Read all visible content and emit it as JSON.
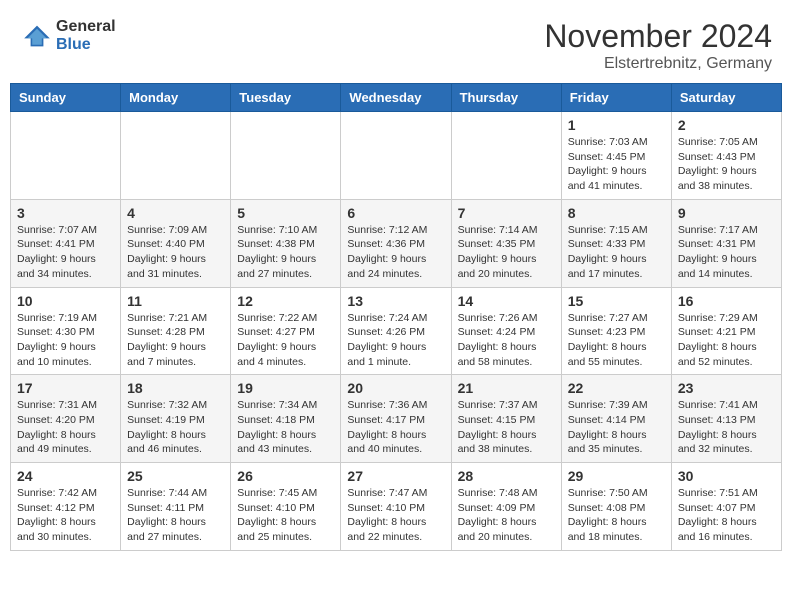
{
  "header": {
    "logo_general": "General",
    "logo_blue": "Blue",
    "month_title": "November 2024",
    "location": "Elstertrebnitz, Germany"
  },
  "calendar": {
    "weekdays": [
      "Sunday",
      "Monday",
      "Tuesday",
      "Wednesday",
      "Thursday",
      "Friday",
      "Saturday"
    ],
    "weeks": [
      [
        {
          "day": "",
          "info": ""
        },
        {
          "day": "",
          "info": ""
        },
        {
          "day": "",
          "info": ""
        },
        {
          "day": "",
          "info": ""
        },
        {
          "day": "",
          "info": ""
        },
        {
          "day": "1",
          "info": "Sunrise: 7:03 AM\nSunset: 4:45 PM\nDaylight: 9 hours\nand 41 minutes."
        },
        {
          "day": "2",
          "info": "Sunrise: 7:05 AM\nSunset: 4:43 PM\nDaylight: 9 hours\nand 38 minutes."
        }
      ],
      [
        {
          "day": "3",
          "info": "Sunrise: 7:07 AM\nSunset: 4:41 PM\nDaylight: 9 hours\nand 34 minutes."
        },
        {
          "day": "4",
          "info": "Sunrise: 7:09 AM\nSunset: 4:40 PM\nDaylight: 9 hours\nand 31 minutes."
        },
        {
          "day": "5",
          "info": "Sunrise: 7:10 AM\nSunset: 4:38 PM\nDaylight: 9 hours\nand 27 minutes."
        },
        {
          "day": "6",
          "info": "Sunrise: 7:12 AM\nSunset: 4:36 PM\nDaylight: 9 hours\nand 24 minutes."
        },
        {
          "day": "7",
          "info": "Sunrise: 7:14 AM\nSunset: 4:35 PM\nDaylight: 9 hours\nand 20 minutes."
        },
        {
          "day": "8",
          "info": "Sunrise: 7:15 AM\nSunset: 4:33 PM\nDaylight: 9 hours\nand 17 minutes."
        },
        {
          "day": "9",
          "info": "Sunrise: 7:17 AM\nSunset: 4:31 PM\nDaylight: 9 hours\nand 14 minutes."
        }
      ],
      [
        {
          "day": "10",
          "info": "Sunrise: 7:19 AM\nSunset: 4:30 PM\nDaylight: 9 hours\nand 10 minutes."
        },
        {
          "day": "11",
          "info": "Sunrise: 7:21 AM\nSunset: 4:28 PM\nDaylight: 9 hours\nand 7 minutes."
        },
        {
          "day": "12",
          "info": "Sunrise: 7:22 AM\nSunset: 4:27 PM\nDaylight: 9 hours\nand 4 minutes."
        },
        {
          "day": "13",
          "info": "Sunrise: 7:24 AM\nSunset: 4:26 PM\nDaylight: 9 hours\nand 1 minute."
        },
        {
          "day": "14",
          "info": "Sunrise: 7:26 AM\nSunset: 4:24 PM\nDaylight: 8 hours\nand 58 minutes."
        },
        {
          "day": "15",
          "info": "Sunrise: 7:27 AM\nSunset: 4:23 PM\nDaylight: 8 hours\nand 55 minutes."
        },
        {
          "day": "16",
          "info": "Sunrise: 7:29 AM\nSunset: 4:21 PM\nDaylight: 8 hours\nand 52 minutes."
        }
      ],
      [
        {
          "day": "17",
          "info": "Sunrise: 7:31 AM\nSunset: 4:20 PM\nDaylight: 8 hours\nand 49 minutes."
        },
        {
          "day": "18",
          "info": "Sunrise: 7:32 AM\nSunset: 4:19 PM\nDaylight: 8 hours\nand 46 minutes."
        },
        {
          "day": "19",
          "info": "Sunrise: 7:34 AM\nSunset: 4:18 PM\nDaylight: 8 hours\nand 43 minutes."
        },
        {
          "day": "20",
          "info": "Sunrise: 7:36 AM\nSunset: 4:17 PM\nDaylight: 8 hours\nand 40 minutes."
        },
        {
          "day": "21",
          "info": "Sunrise: 7:37 AM\nSunset: 4:15 PM\nDaylight: 8 hours\nand 38 minutes."
        },
        {
          "day": "22",
          "info": "Sunrise: 7:39 AM\nSunset: 4:14 PM\nDaylight: 8 hours\nand 35 minutes."
        },
        {
          "day": "23",
          "info": "Sunrise: 7:41 AM\nSunset: 4:13 PM\nDaylight: 8 hours\nand 32 minutes."
        }
      ],
      [
        {
          "day": "24",
          "info": "Sunrise: 7:42 AM\nSunset: 4:12 PM\nDaylight: 8 hours\nand 30 minutes."
        },
        {
          "day": "25",
          "info": "Sunrise: 7:44 AM\nSunset: 4:11 PM\nDaylight: 8 hours\nand 27 minutes."
        },
        {
          "day": "26",
          "info": "Sunrise: 7:45 AM\nSunset: 4:10 PM\nDaylight: 8 hours\nand 25 minutes."
        },
        {
          "day": "27",
          "info": "Sunrise: 7:47 AM\nSunset: 4:10 PM\nDaylight: 8 hours\nand 22 minutes."
        },
        {
          "day": "28",
          "info": "Sunrise: 7:48 AM\nSunset: 4:09 PM\nDaylight: 8 hours\nand 20 minutes."
        },
        {
          "day": "29",
          "info": "Sunrise: 7:50 AM\nSunset: 4:08 PM\nDaylight: 8 hours\nand 18 minutes."
        },
        {
          "day": "30",
          "info": "Sunrise: 7:51 AM\nSunset: 4:07 PM\nDaylight: 8 hours\nand 16 minutes."
        }
      ]
    ]
  }
}
